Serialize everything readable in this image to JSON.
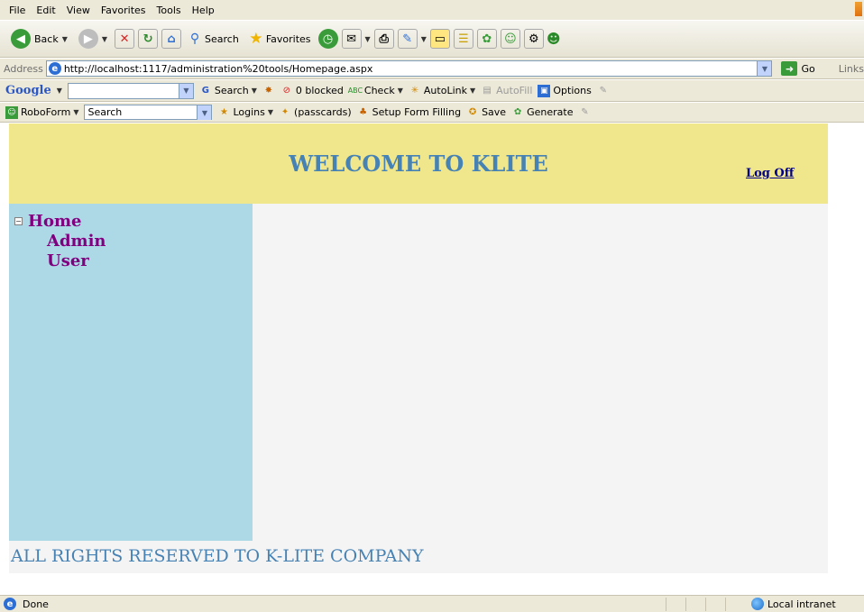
{
  "menu": [
    "File",
    "Edit",
    "View",
    "Favorites",
    "Tools",
    "Help"
  ],
  "toolbar": {
    "back_label": "Back",
    "search_label": "Search",
    "favorites_label": "Favorites"
  },
  "address": {
    "label": "Address",
    "url": "http://localhost:1117/administration%20tools/Homepage.aspx",
    "go_label": "Go",
    "links_label": "Links"
  },
  "google": {
    "logo": "Google",
    "search_label": "Search",
    "blocked_label": "0 blocked",
    "check_label": "Check",
    "autolink_label": "AutoLink",
    "autofill_label": "AutoFill",
    "options_label": "Options"
  },
  "roboform": {
    "logo": "RoboForm",
    "search_value": "Search",
    "logins_label": "Logins",
    "passcards_label": "(passcards)",
    "setup_label": "Setup Form Filling",
    "save_label": "Save",
    "generate_label": "Generate"
  },
  "page": {
    "title": "WELCOME TO KLITE",
    "logoff": "Log Off",
    "tree": {
      "root": "Home",
      "children": [
        "Admin",
        "User"
      ]
    },
    "footer": "ALL RIGHTS RESERVED TO K-LITE COMPANY"
  },
  "status": {
    "text": "Done",
    "zone": "Local intranet"
  },
  "colors": {
    "header_bg": "#f0e68c",
    "sidebar_bg": "#add8e6",
    "title_color": "#4682b4",
    "tree_color": "#800080"
  }
}
